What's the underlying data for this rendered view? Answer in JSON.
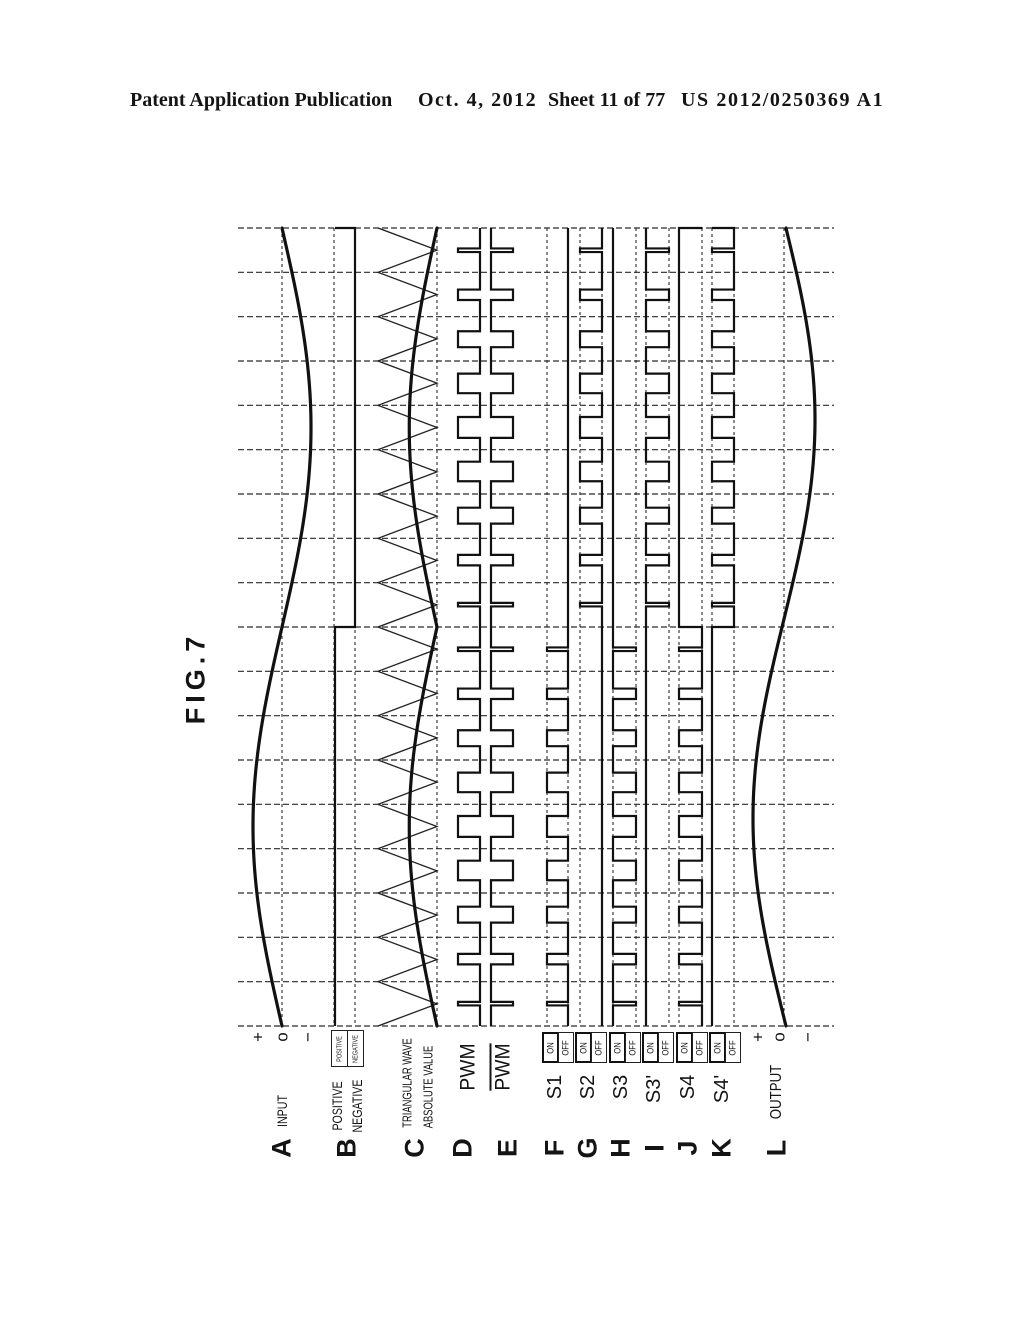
{
  "header": {
    "publication": "Patent Application Publication",
    "date": "Oct. 4, 2012",
    "sheet": "Sheet 11 of 77",
    "number": "US 2012/0250369 A1"
  },
  "figure": {
    "title": "FIG.7",
    "waveform_params": {
      "input_cycles": 1,
      "time_divisions": 18,
      "carrier_periods_per_half_cycle": 9,
      "modulation_index": 0.47,
      "output_phase_lag_cycles": 0.01
    },
    "rows": [
      {
        "letter": "A",
        "label": "INPUT",
        "waveform": "sine",
        "axis": {
          "plus": "+",
          "zero": "o",
          "minus": "−"
        }
      },
      {
        "letter": "B",
        "label_lines": [
          "POSITIVE",
          "NEGATIVE"
        ],
        "waveform": "polarity",
        "legend": [
          "POSITIVE",
          "NEGATIVE"
        ],
        "positive_half": "POSITIVE",
        "negative_half": "NEGATIVE"
      },
      {
        "letter": "C",
        "label_lines": [
          "TRIANGULAR WAVE",
          "ABSOLUTE VALUE"
        ],
        "waveform": "triangle_and_abs"
      },
      {
        "letter": "D",
        "label": "PWM",
        "waveform": "pwm"
      },
      {
        "letter": "E",
        "label": "PWM",
        "overline": true,
        "waveform": "pwm_inverted"
      },
      {
        "letter": "F",
        "label": "S1",
        "states": [
          "ON",
          "OFF"
        ],
        "positive_half": "pwm",
        "negative_half": "off"
      },
      {
        "letter": "G",
        "label": "S2",
        "states": [
          "ON",
          "OFF"
        ],
        "positive_half": "off",
        "negative_half": "pwm"
      },
      {
        "letter": "H",
        "label": "S3",
        "states": [
          "ON",
          "OFF"
        ],
        "positive_half": "pwm_inverted",
        "negative_half": "on"
      },
      {
        "letter": "I",
        "label": "S3'",
        "states": [
          "ON",
          "OFF"
        ],
        "positive_half": "on",
        "negative_half": "pwm_inverted"
      },
      {
        "letter": "J",
        "label": "S4",
        "states": [
          "ON",
          "OFF"
        ],
        "positive_half": "pwm",
        "negative_half": "on"
      },
      {
        "letter": "K",
        "label": "S4'",
        "states": [
          "ON",
          "OFF"
        ],
        "positive_half": "on",
        "negative_half": "pwm"
      },
      {
        "letter": "L",
        "label": "OUTPUT",
        "waveform": "sine",
        "axis": {
          "plus": "+",
          "zero": "o",
          "minus": "−"
        }
      }
    ]
  }
}
